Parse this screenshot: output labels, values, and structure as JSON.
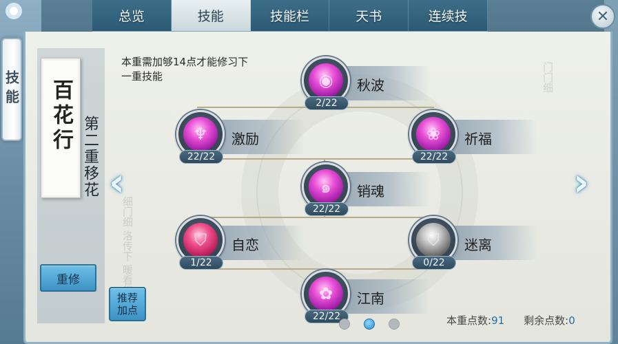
{
  "side_tab": {
    "label": "技能"
  },
  "tabs": [
    {
      "label": "总览",
      "active": false
    },
    {
      "label": "技能",
      "active": true
    },
    {
      "label": "技能栏",
      "active": false
    },
    {
      "label": "天书",
      "active": false
    },
    {
      "label": "连续技",
      "active": false
    }
  ],
  "close": {
    "symbol": "✕"
  },
  "school": {
    "name": "百花行",
    "stage": "第二重移花"
  },
  "hint": "本重需加够14点才能修习下一重技能",
  "buttons": {
    "reset": "重修",
    "recommend": "推荐加点"
  },
  "skills": [
    {
      "name": "秋波",
      "level": "2/22",
      "icon": "eye-orb-icon"
    },
    {
      "name": "激励",
      "level": "22/22",
      "icon": "fountain-orb-icon"
    },
    {
      "name": "祈福",
      "level": "22/22",
      "icon": "lotus-orb-icon"
    },
    {
      "name": "销魂",
      "level": "22/22",
      "icon": "swirl-orb-icon"
    },
    {
      "name": "自恋",
      "level": "1/22",
      "icon": "shield-orb-icon"
    },
    {
      "name": "迷离",
      "level": "0/22",
      "icon": "grey-shield-orb-icon"
    },
    {
      "name": "江南",
      "level": "22/22",
      "icon": "flower-orb-icon"
    }
  ],
  "nav": {
    "prev": "‹",
    "next": "›"
  },
  "pager": {
    "count": 3,
    "active_index": 1
  },
  "stats": {
    "current_points_label": "本重点数:",
    "current_points": "91",
    "remaining_points_label": "剩余点数:",
    "remaining_points": "0"
  },
  "colors": {
    "accent": "#3d92c4",
    "orb": "#e84fd6",
    "stat_value": "#1f6fa6"
  }
}
